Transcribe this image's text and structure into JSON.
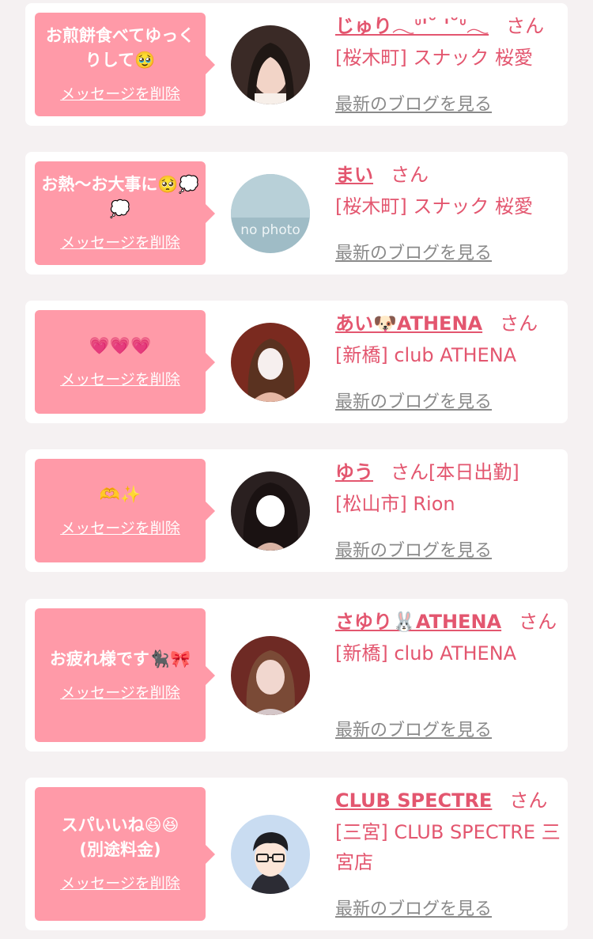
{
  "suffix": "さん",
  "delete_label": "メッセージを削除",
  "blog_label": "最新のブログを見る",
  "items": [
    {
      "message": "お煎餅食べてゆっくりして🥹",
      "name": "じゅり𓂃ᐡ'˘ '˘ᐡ𓂃",
      "shop": "[桜木町] スナック 桜愛",
      "extra": ""
    },
    {
      "message": "お熱〜お大事に🥺💭💭",
      "name": "まい",
      "shop": "[桜木町] スナック 桜愛",
      "extra": "",
      "avatar_text": "no photo"
    },
    {
      "message": "💗💗💗",
      "name": "あい🐶ATHENA",
      "shop": "[新橋] club ATHENA",
      "extra": ""
    },
    {
      "message": "🫶✨",
      "name": "ゆう",
      "shop": "[松山市] Rion",
      "extra": "[本日出勤]"
    },
    {
      "message": "お疲れ様です🐈‍⬛🎀",
      "name": "さゆり🐰ATHENA",
      "shop": "[新橋] club ATHENA",
      "extra": ""
    },
    {
      "message": "スパいいね😆😆\n(別途料金)",
      "name": "CLUB SPECTRE",
      "shop": "[三宮] CLUB SPECTRE 三宮店",
      "extra": ""
    }
  ]
}
